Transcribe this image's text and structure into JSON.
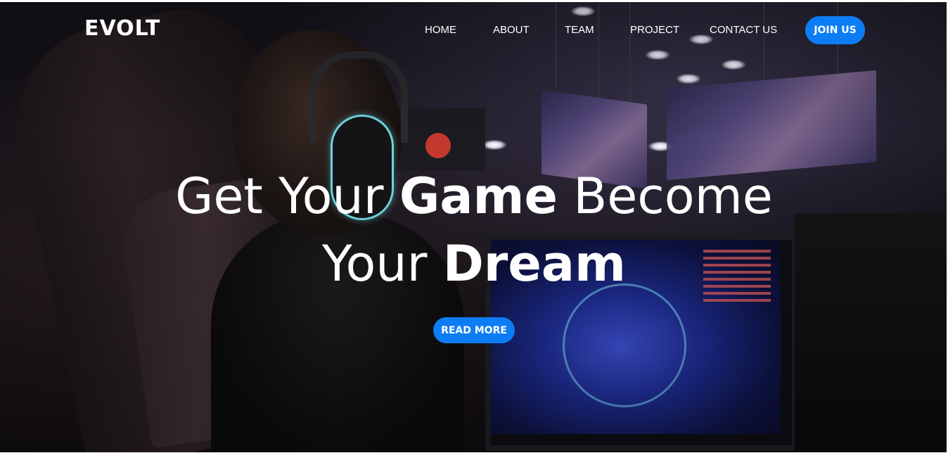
{
  "brand": {
    "name": "EVOLT"
  },
  "nav": {
    "items": [
      {
        "label": "HOME"
      },
      {
        "label": "ABOUT"
      },
      {
        "label": "TEAM"
      },
      {
        "label": "PROJECT"
      },
      {
        "label": "CONTACT US"
      }
    ],
    "cta_label": "JOIN US"
  },
  "hero": {
    "line1_pre": "Get Your ",
    "line1_bold": "Game",
    "line1_post": " Become",
    "line2_pre": "Your ",
    "line2_bold": "Dream",
    "button_label": "READ MORE",
    "background_icon": "gaming-photo-background"
  },
  "colors": {
    "accent": "#0d7df5",
    "text": "#ffffff"
  }
}
